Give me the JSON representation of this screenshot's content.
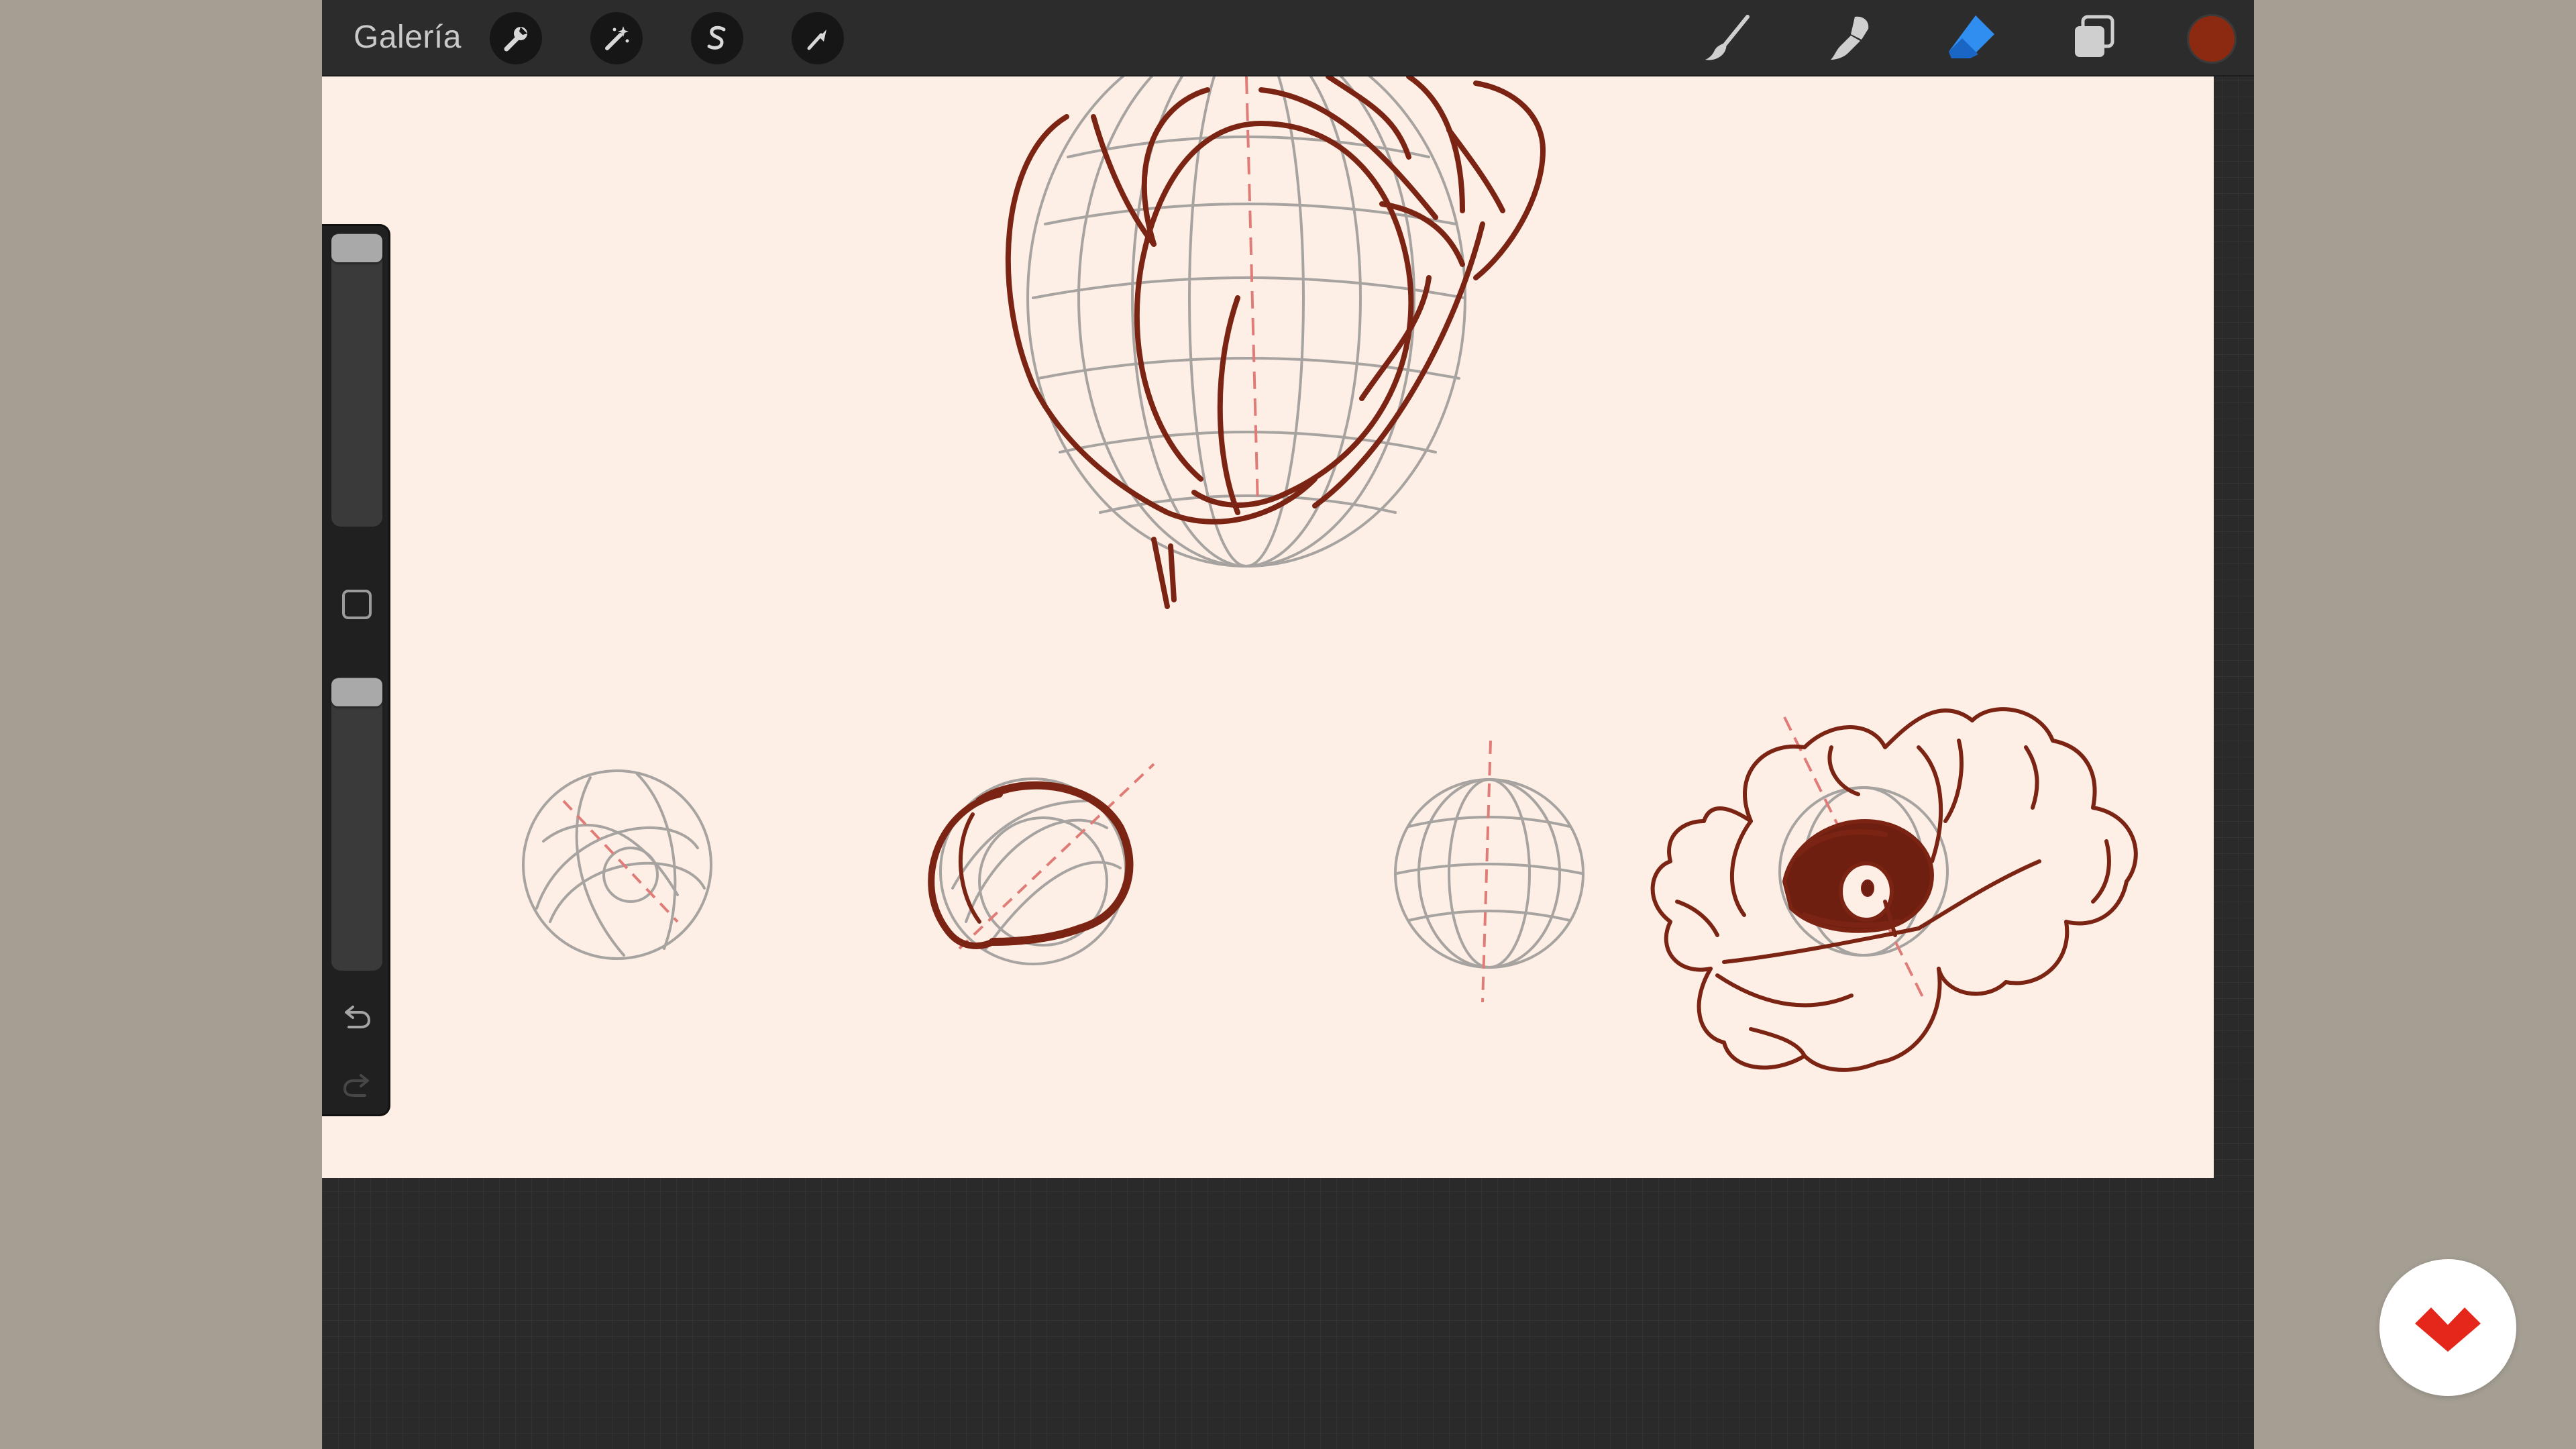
{
  "app": {
    "gallery_label": "Galería"
  },
  "toolbar_left": {
    "icons": [
      "wrench-icon",
      "magic-wand-icon",
      "selection-s-icon",
      "transform-arrow-icon"
    ]
  },
  "toolbar_right": {
    "icons": [
      "brush-icon",
      "smudge-icon",
      "eraser-icon",
      "layers-icon"
    ],
    "active_tool": "eraser",
    "active_color": "#8b2a10",
    "highlight_color": "#2f8ef0"
  },
  "sidebar": {
    "brush_size_level": 0.0,
    "opacity_level": 0.0,
    "icons": [
      "modify-square-icon",
      "undo-icon",
      "redo-icon"
    ]
  },
  "canvas": {
    "background": "#fdefe5",
    "ink_color": "#7c2413",
    "guide_color": "#a7a3a0",
    "axis_color": "#e07c78"
  },
  "overlay": {
    "logo_color": "#e4261b"
  }
}
